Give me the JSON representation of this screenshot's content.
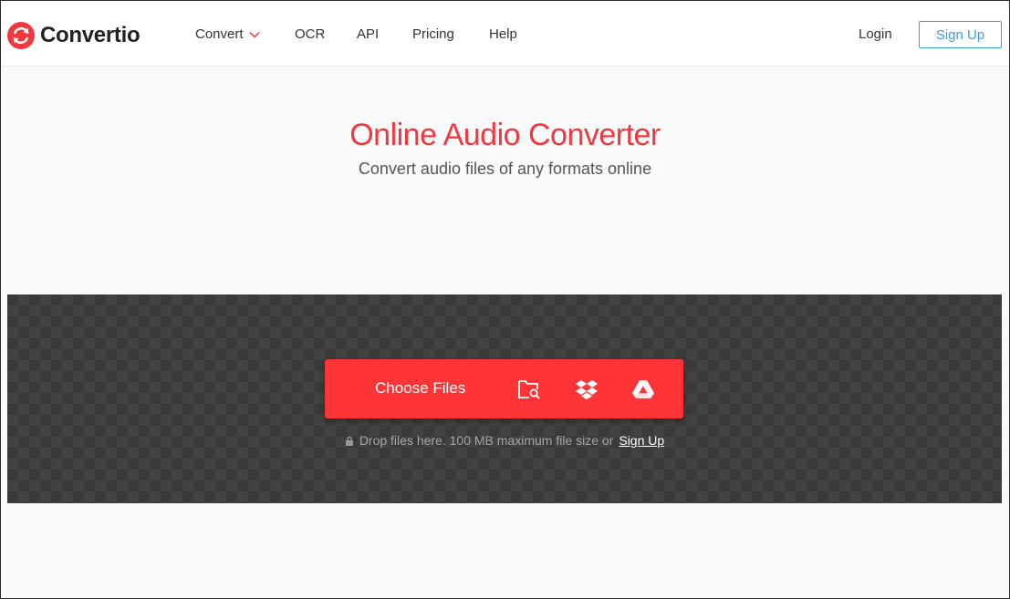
{
  "brand": {
    "name": "Convertio",
    "color": "#f1383f"
  },
  "nav": {
    "items": [
      {
        "label": "Convert",
        "has_dropdown": true
      },
      {
        "label": "OCR"
      },
      {
        "label": "API"
      },
      {
        "label": "Pricing"
      },
      {
        "label": "Help"
      }
    ],
    "login_label": "Login",
    "signup_label": "Sign Up"
  },
  "hero": {
    "title": "Online Audio Converter",
    "subtitle": "Convert audio files of any formats online"
  },
  "upload": {
    "choose_label": "Choose Files",
    "sources": [
      "folder-search-icon",
      "dropbox-icon",
      "google-drive-icon"
    ],
    "hint_text": "Drop files here. 100 MB maximum file size or",
    "hint_link": "Sign Up"
  },
  "colors": {
    "accent": "#ff3437",
    "signup_blue": "#3a9ee0",
    "drop_bg": "#3a3a3a"
  }
}
